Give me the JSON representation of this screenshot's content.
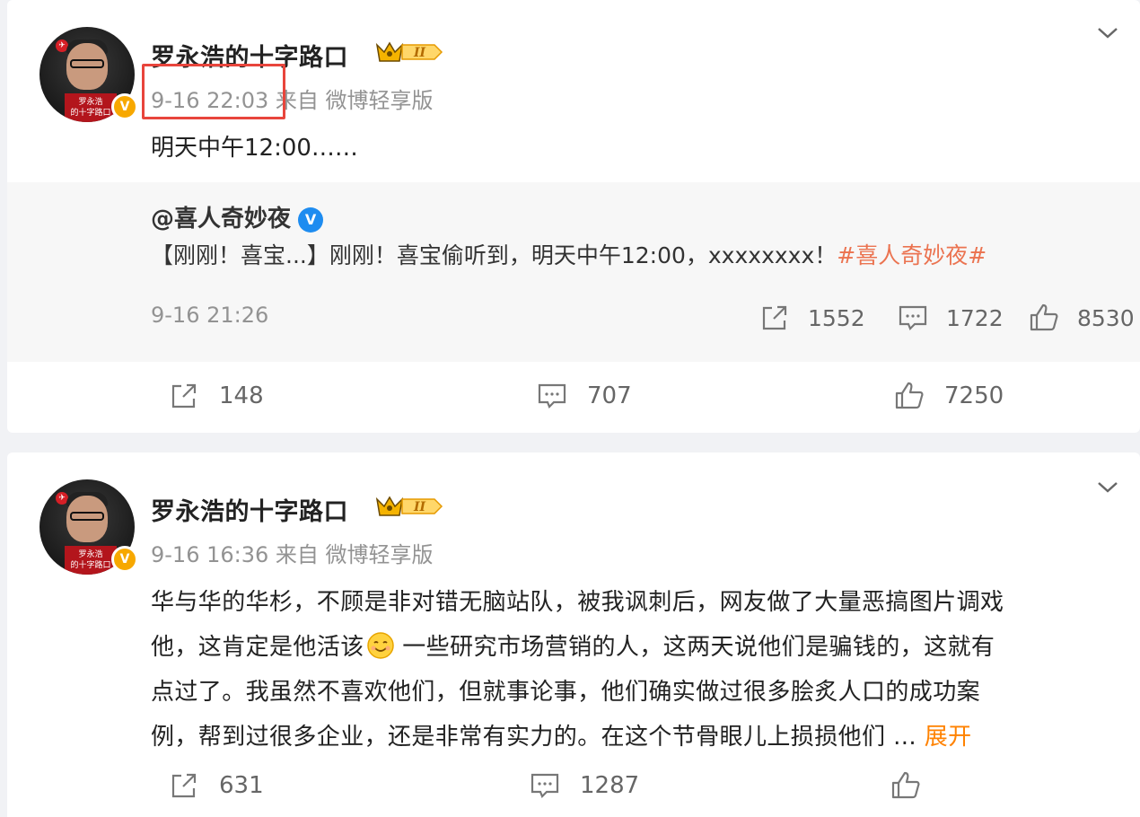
{
  "colors": {
    "accent_orange": "#ff8200",
    "hashtag": "#eb7350",
    "verified_blue": "#1e8cf0",
    "highlight_red": "#e8453c",
    "meta_gray": "#939393"
  },
  "post1": {
    "author": "罗永浩的十字路口",
    "avatar_caption_line1": "罗永浩",
    "avatar_caption_line2": "的十字路口",
    "badge_icon": "crown-level-badge",
    "timestamp": "9-16 22:03",
    "source": "来自 微博轻享版",
    "content": "明天中午12:00……",
    "repost": {
      "author": "@喜人奇妙夜",
      "text_prefix": "【刚刚！喜宝...】刚刚！喜宝偷听到，明天中午12:00，xxxxxxxx！",
      "hashtag": "#喜人奇妙夜#",
      "timestamp": "9-16 21:26",
      "shares": "1552",
      "comments": "1722",
      "likes": "8530"
    },
    "shares": "148",
    "comments": "707",
    "likes": "7250"
  },
  "post2": {
    "author": "罗永浩的十字路口",
    "timestamp": "9-16 16:36",
    "source": "来自 微博轻享版",
    "content_line1": "华与华的华杉，不顾是非对错无脑站队，被我讽刺后，网友做了大量恶搞图片调戏",
    "content_line2a": "他，这肯定是他活该",
    "content_line2b": " 一些研究市场营销的人，这两天说他们是骗钱的，这就有",
    "content_line3": "点过了。我虽然不喜欢他们，但就事论事，他们确实做过很多脍炙人口的成功案",
    "content_line4": "例，帮到过很多企业，还是非常有实力的。在这个节骨眼儿上损损他们 ... ",
    "expand_label": "展开",
    "shares": "631",
    "comments": "1287"
  }
}
